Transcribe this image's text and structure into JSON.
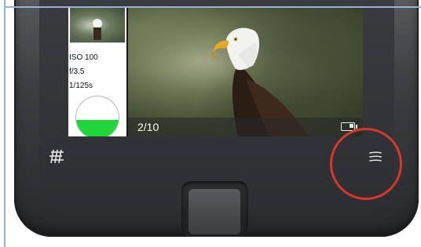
{
  "screen": {
    "info_lines": [
      "ISO 100",
      "f/3.5",
      "1/125s"
    ],
    "counter": "2/10",
    "battery_level": 0.4,
    "gauge_level": 0.45
  },
  "controls": {
    "grid_icon": "grid-icon",
    "menu_icon": "menu-icon",
    "home_icon": "home-button"
  },
  "colors": {
    "highlight": "#d9372e",
    "gauge_fill": "#1fd63a",
    "body": "#3b3c3f"
  }
}
